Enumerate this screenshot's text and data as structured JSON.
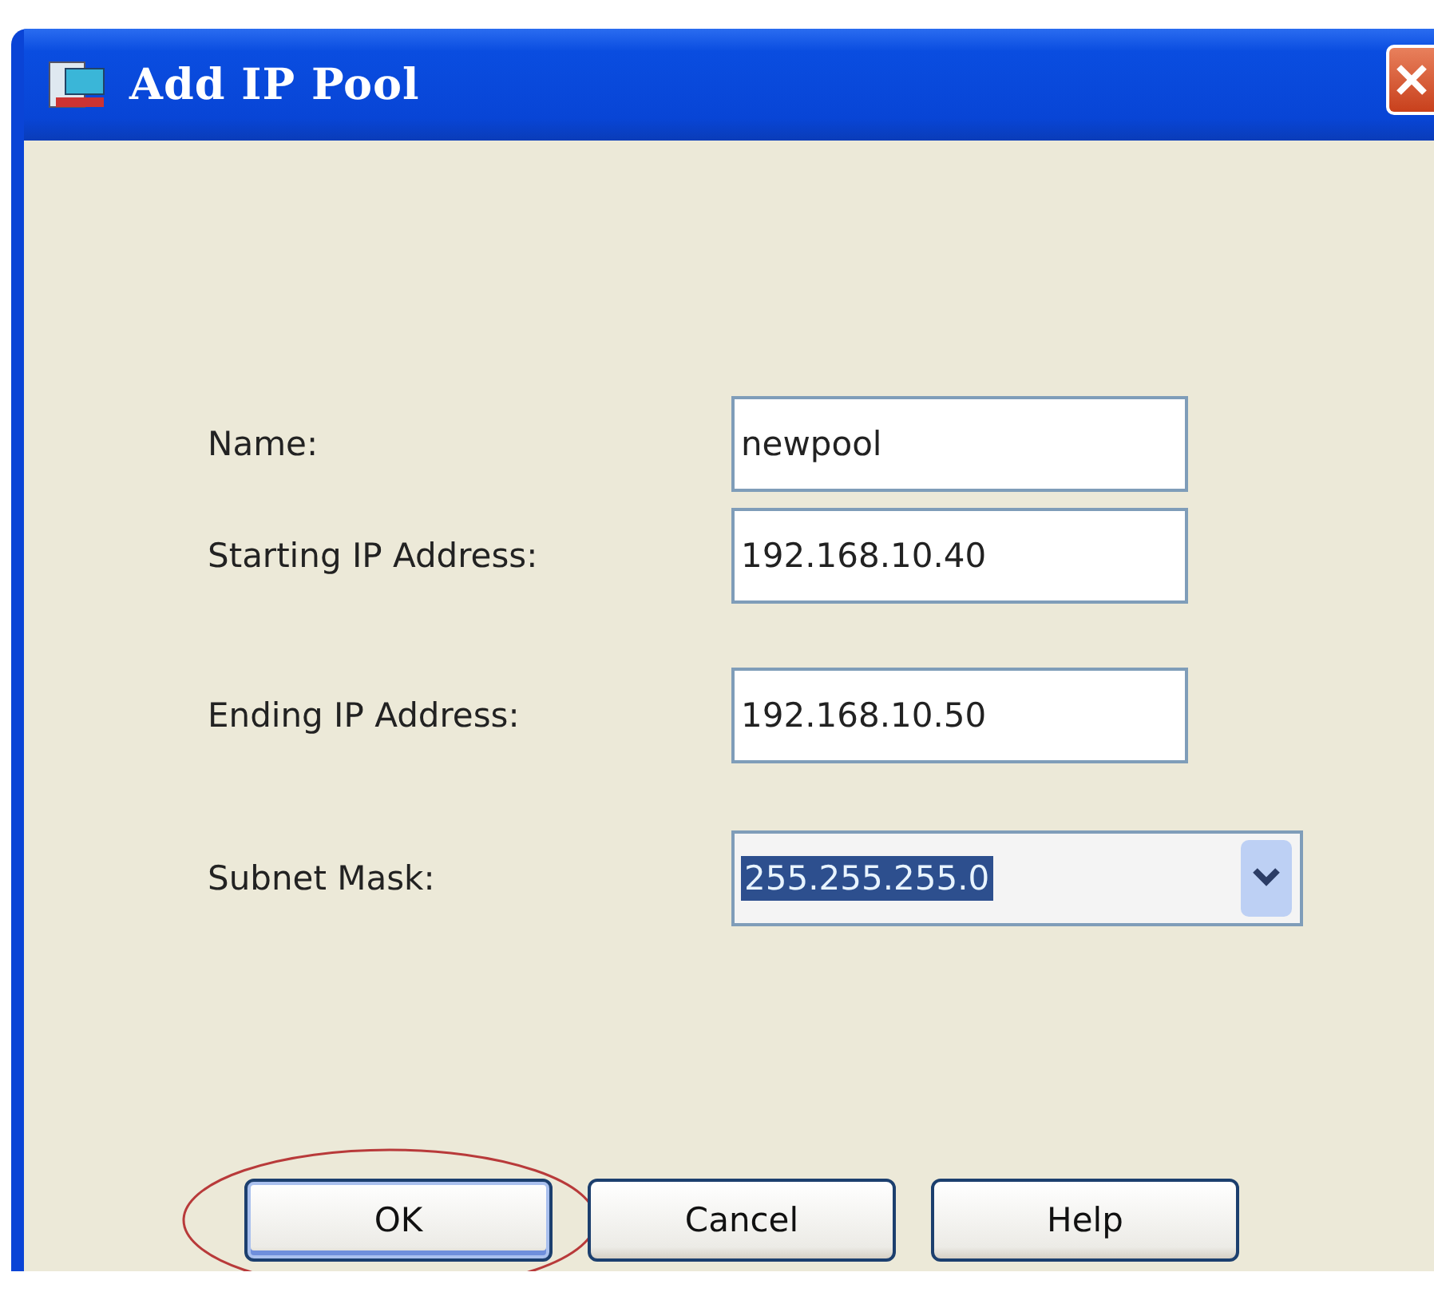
{
  "window": {
    "title": "Add IP Pool"
  },
  "fields": [
    {
      "kind": "text",
      "label": "Name:",
      "value": "newpool"
    },
    {
      "kind": "text",
      "label": "Starting IP Address:",
      "value": "192.168.10.40"
    },
    {
      "kind": "text",
      "label": "Ending IP Address:",
      "value": "192.168.10.50"
    },
    {
      "kind": "combo",
      "label": "Subnet Mask:",
      "value": "255.255.255.0",
      "value_selected": true
    }
  ],
  "buttons": [
    {
      "label": "OK",
      "default": true,
      "circled": true
    },
    {
      "label": "Cancel",
      "default": false,
      "circled": false
    },
    {
      "label": "Help",
      "default": false,
      "circled": false
    }
  ]
}
